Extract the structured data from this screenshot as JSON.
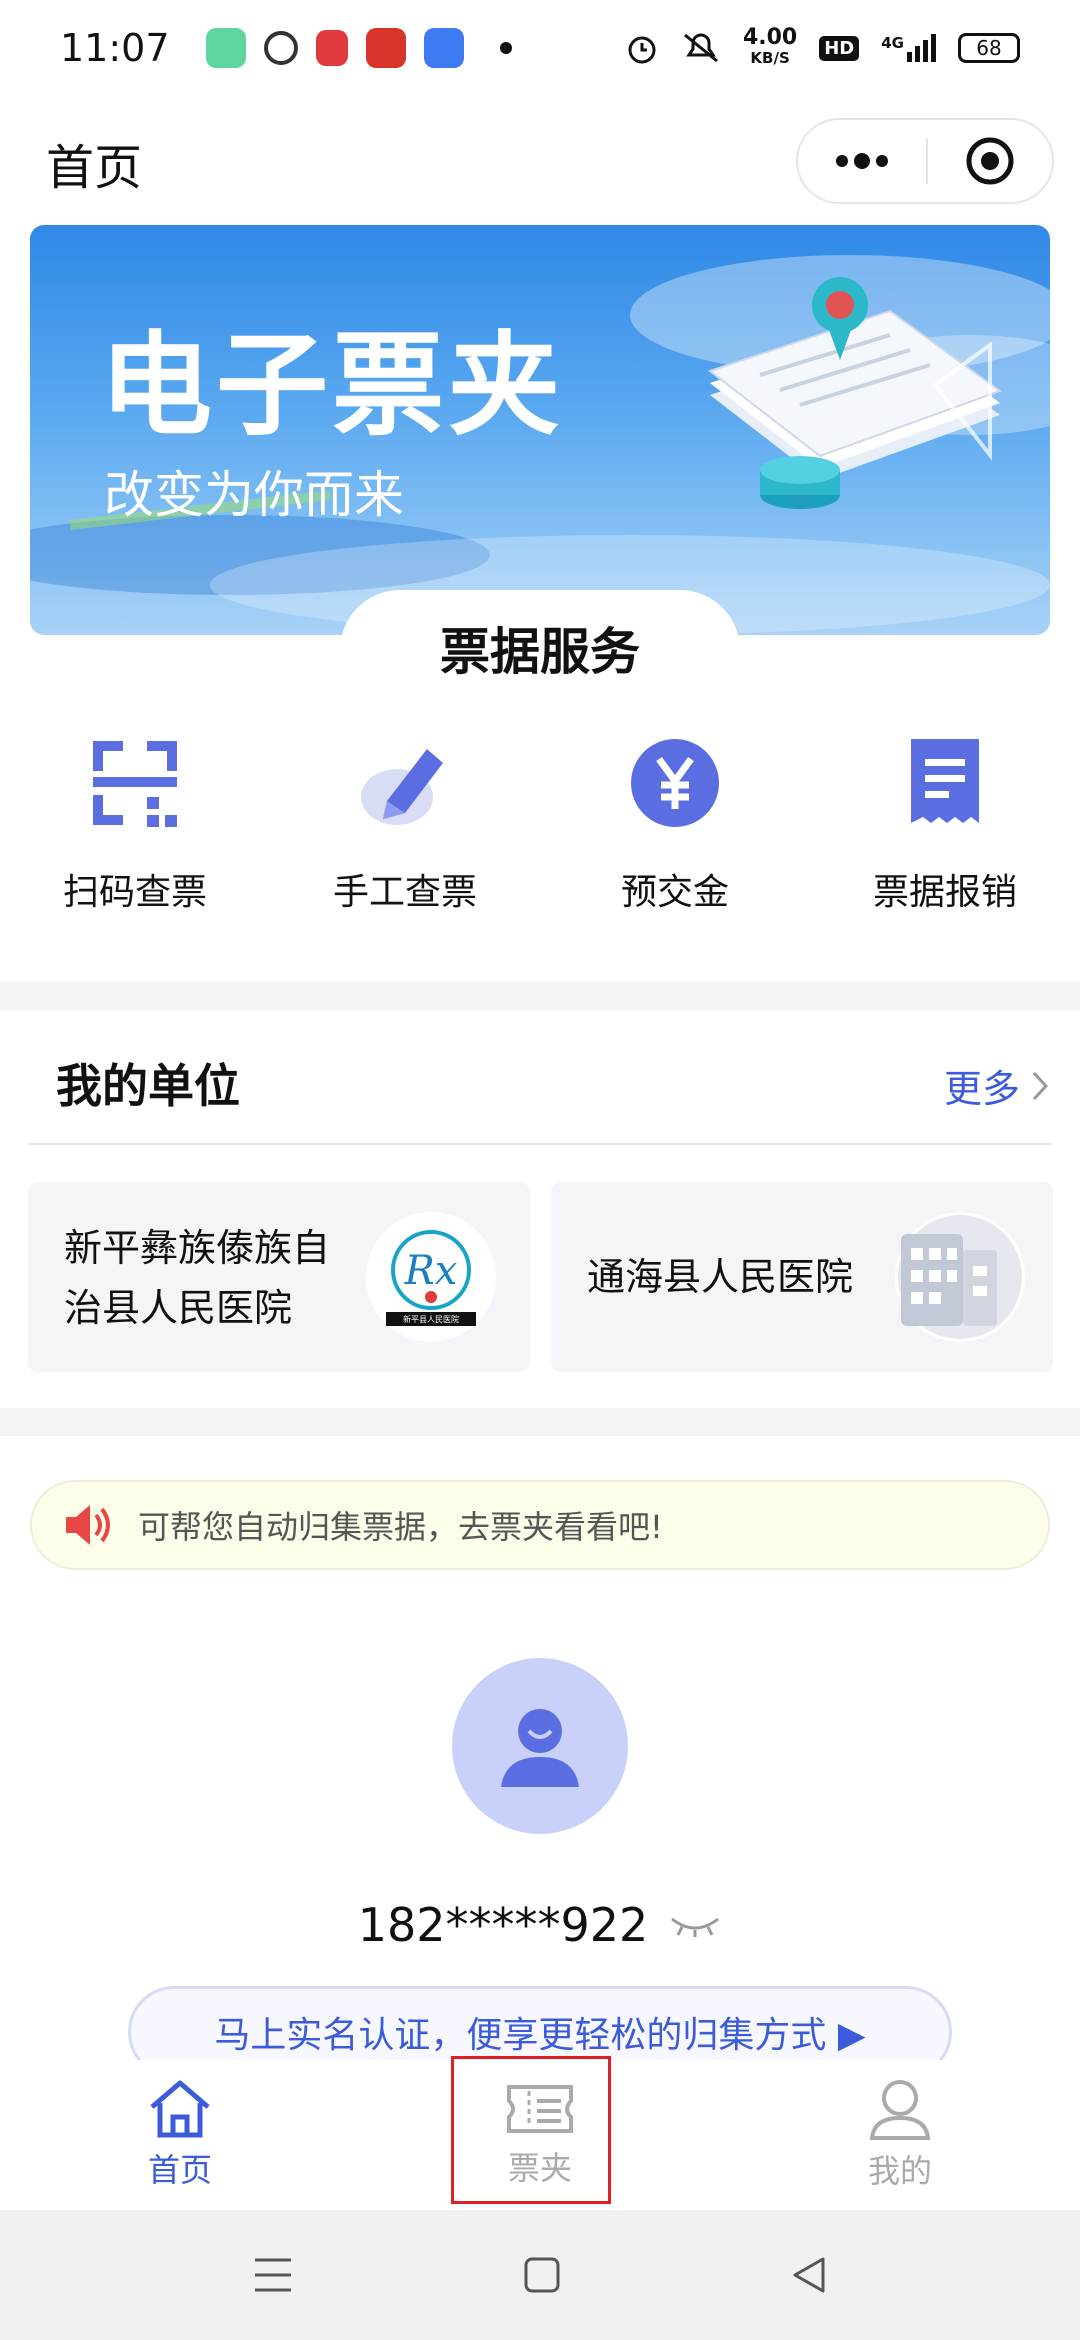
{
  "status_bar": {
    "time": "11:07",
    "net_speed_value": "4.00",
    "net_speed_unit": "KB/S",
    "hd_badge": "HD",
    "signal_label": "4G",
    "battery": "68"
  },
  "header": {
    "title": "首页"
  },
  "banner": {
    "title": "电子票夹",
    "subtitle": "改变为你而来"
  },
  "services": {
    "section_title": "票据服务",
    "items": [
      {
        "label": "扫码查票",
        "icon": "qr-scan-icon"
      },
      {
        "label": "手工查票",
        "icon": "pen-edit-icon"
      },
      {
        "label": "预交金",
        "icon": "yen-coin-icon"
      },
      {
        "label": "票据报销",
        "icon": "receipt-icon"
      }
    ]
  },
  "units": {
    "title": "我的单位",
    "more_label": "更多",
    "cards": [
      {
        "name_line1": "新平彝族傣族自",
        "name_line2": "治县人民医院",
        "logo_caption": "新平县人民医院"
      },
      {
        "name": "通海县人民医院"
      }
    ]
  },
  "notice": {
    "text": "可帮您自动归集票据，去票夹看看吧!"
  },
  "profile": {
    "phone": "182*****922",
    "cta_label": "马上实名认证，便享更轻松的归集方式 ▶"
  },
  "tabbar": {
    "items": [
      {
        "label": "首页",
        "active": true
      },
      {
        "label": "票夹",
        "active": false
      },
      {
        "label": "我的",
        "active": false
      }
    ]
  },
  "colors": {
    "accent": "#3b5bdb",
    "service_icon": "#5b6ee1",
    "highlight": "#e02020"
  }
}
